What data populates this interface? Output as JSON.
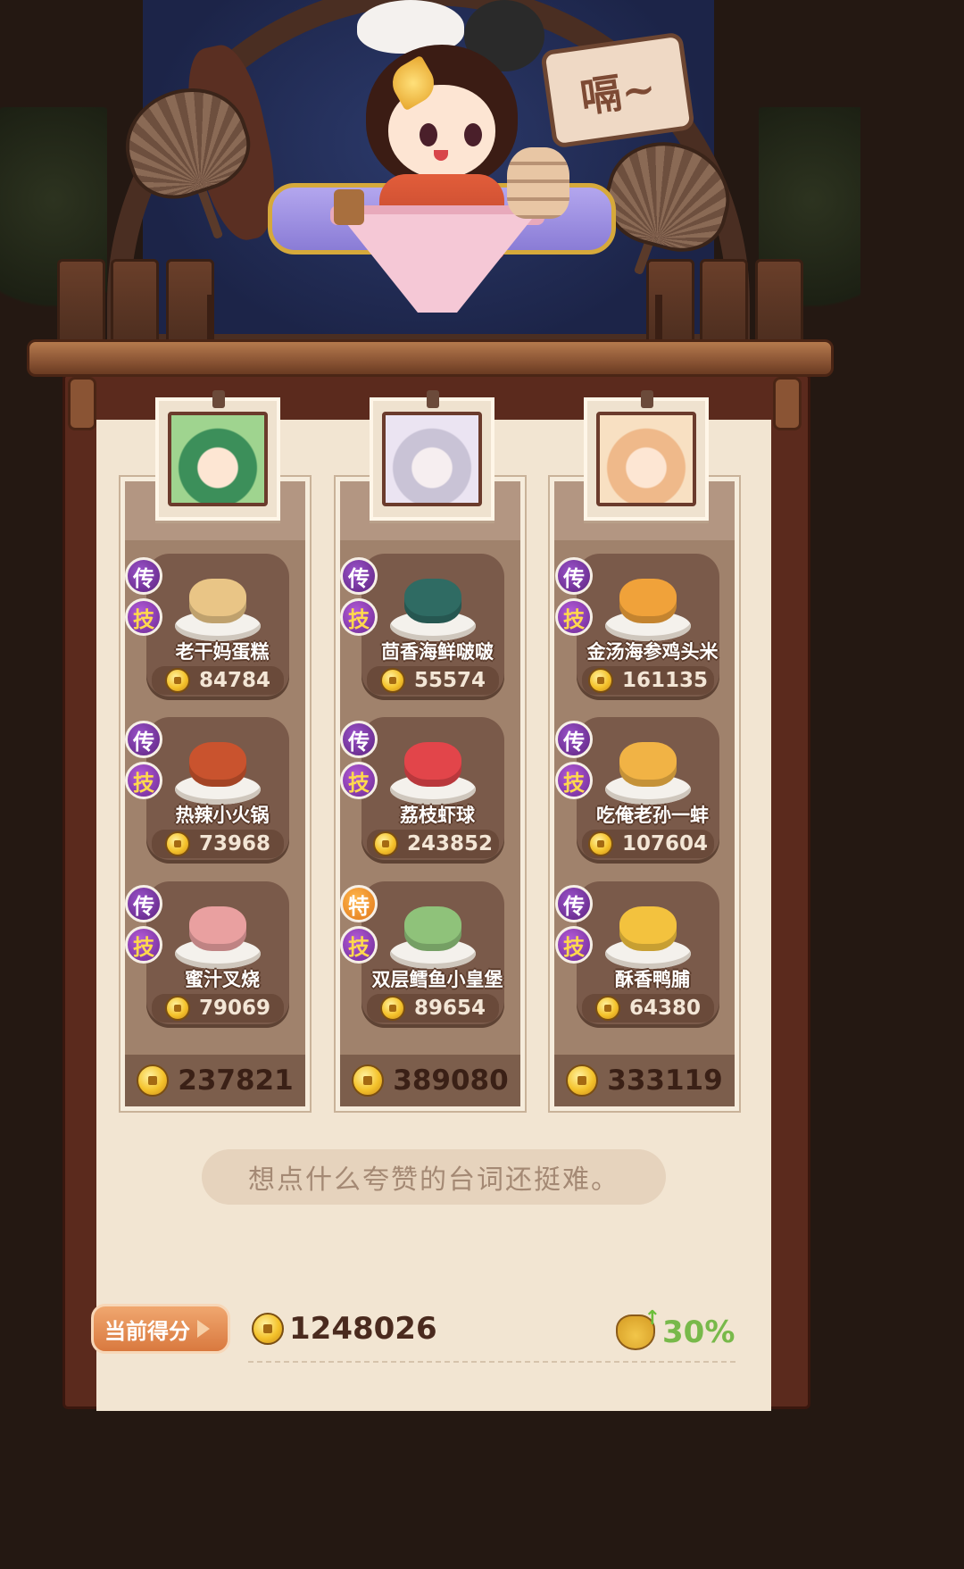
{
  "sign_text": "嗝~",
  "columns": [
    {
      "chef_icon": "green-haired-chef-portrait",
      "total": "237821",
      "dishes": [
        {
          "tier": "传",
          "skill": "技",
          "name": "老干妈蛋糕",
          "score": "84784",
          "food_color": "#e9c586"
        },
        {
          "tier": "传",
          "skill": "技",
          "name": "热辣小火锅",
          "score": "73968",
          "food_color": "#c9532e"
        },
        {
          "tier": "传",
          "skill": "技",
          "name": "蜜汁叉烧",
          "score": "79069",
          "food_color": "#e9a0a0"
        }
      ]
    },
    {
      "chef_icon": "silver-haired-chef-portrait",
      "total": "389080",
      "dishes": [
        {
          "tier": "传",
          "skill": "技",
          "name": "茴香海鲜啵啵",
          "score": "55574",
          "food_color": "#2f6b63"
        },
        {
          "tier": "传",
          "skill": "技",
          "name": "荔枝虾球",
          "score": "243852",
          "food_color": "#e2454a"
        },
        {
          "tier": "特",
          "skill": "技",
          "name": "双层鳕鱼小皇堡",
          "score": "89654",
          "food_color": "#8fc27a"
        }
      ]
    },
    {
      "chef_icon": "peach-haired-chef-portrait",
      "total": "333119",
      "dishes": [
        {
          "tier": "传",
          "skill": "技",
          "name": "金汤海参鸡头米",
          "score": "161135",
          "food_color": "#f0a23a"
        },
        {
          "tier": "传",
          "skill": "技",
          "name": "吃俺老孙一蚌",
          "score": "107604",
          "food_color": "#f1b345"
        },
        {
          "tier": "传",
          "skill": "技",
          "name": "酥香鸭脯",
          "score": "64380",
          "food_color": "#f3c23e"
        }
      ]
    }
  ],
  "quote": "想点什么夸赞的台词还挺难。",
  "footer": {
    "label": "当前得分",
    "score": "1248026",
    "bonus": "30%"
  }
}
